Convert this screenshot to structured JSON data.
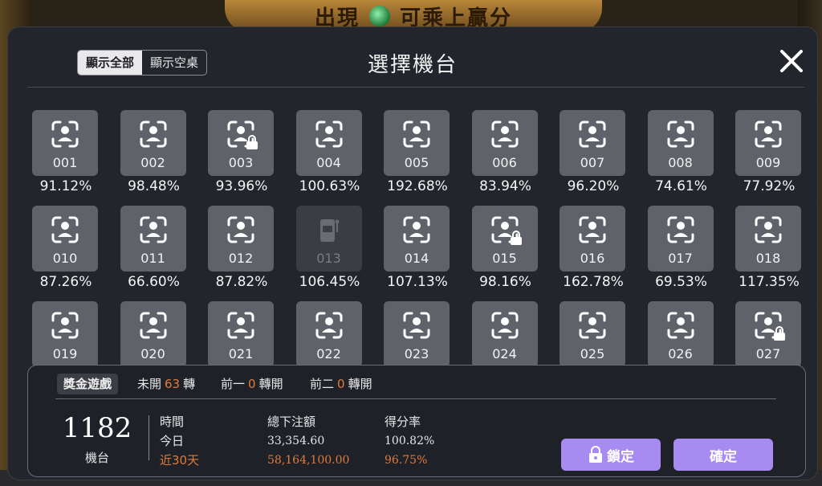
{
  "background": {
    "banner_text_left": "出現",
    "banner_text_right": "可乘上贏分"
  },
  "header": {
    "filters": [
      {
        "label": "顯示全部",
        "active": true
      },
      {
        "label": "顯示空桌",
        "active": false
      }
    ],
    "title": "選擇機台",
    "close_icon": "close-icon"
  },
  "machines": [
    {
      "number": "001",
      "rate": "91.12%",
      "locked": false,
      "disabled": false
    },
    {
      "number": "002",
      "rate": "98.48%",
      "locked": false,
      "disabled": false
    },
    {
      "number": "003",
      "rate": "93.96%",
      "locked": true,
      "disabled": false
    },
    {
      "number": "004",
      "rate": "100.63%",
      "locked": false,
      "disabled": false
    },
    {
      "number": "005",
      "rate": "192.68%",
      "locked": false,
      "disabled": false
    },
    {
      "number": "006",
      "rate": "83.94%",
      "locked": false,
      "disabled": false
    },
    {
      "number": "007",
      "rate": "96.20%",
      "locked": false,
      "disabled": false
    },
    {
      "number": "008",
      "rate": "74.61%",
      "locked": false,
      "disabled": false
    },
    {
      "number": "009",
      "rate": "77.92%",
      "locked": false,
      "disabled": false
    },
    {
      "number": "010",
      "rate": "87.26%",
      "locked": false,
      "disabled": false
    },
    {
      "number": "011",
      "rate": "66.60%",
      "locked": false,
      "disabled": false
    },
    {
      "number": "012",
      "rate": "87.82%",
      "locked": false,
      "disabled": false
    },
    {
      "number": "013",
      "rate": "106.45%",
      "locked": false,
      "disabled": true
    },
    {
      "number": "014",
      "rate": "107.13%",
      "locked": false,
      "disabled": false
    },
    {
      "number": "015",
      "rate": "98.16%",
      "locked": true,
      "disabled": false
    },
    {
      "number": "016",
      "rate": "162.78%",
      "locked": false,
      "disabled": false
    },
    {
      "number": "017",
      "rate": "69.53%",
      "locked": false,
      "disabled": false
    },
    {
      "number": "018",
      "rate": "117.35%",
      "locked": false,
      "disabled": false
    },
    {
      "number": "019",
      "rate": "",
      "locked": false,
      "disabled": false
    },
    {
      "number": "020",
      "rate": "",
      "locked": false,
      "disabled": false
    },
    {
      "number": "021",
      "rate": "",
      "locked": false,
      "disabled": false
    },
    {
      "number": "022",
      "rate": "",
      "locked": false,
      "disabled": false
    },
    {
      "number": "023",
      "rate": "",
      "locked": false,
      "disabled": false
    },
    {
      "number": "024",
      "rate": "",
      "locked": false,
      "disabled": false
    },
    {
      "number": "025",
      "rate": "",
      "locked": false,
      "disabled": false
    },
    {
      "number": "026",
      "rate": "",
      "locked": false,
      "disabled": false
    },
    {
      "number": "027",
      "rate": "",
      "locked": true,
      "disabled": false
    }
  ],
  "info": {
    "jackpot_label": "獎金遊戲",
    "not_opened": {
      "label": "未開",
      "value": "63",
      "unit": "轉"
    },
    "prev1": {
      "label": "前一",
      "value": "0",
      "unit": "轉開"
    },
    "prev2": {
      "label": "前二",
      "value": "0",
      "unit": "轉開"
    },
    "machine_count": "1182",
    "machine_count_label": "機台",
    "table": {
      "headers": [
        "時間",
        "總下注額",
        "得分率"
      ],
      "today": {
        "label": "今日",
        "bet": "33,354.60",
        "rate": "100.82%"
      },
      "last30": {
        "label": "近30天",
        "bet": "58,164,100.00",
        "rate": "96.75%"
      }
    },
    "lock_button": "鎖定",
    "confirm_button": "確定"
  },
  "colors": {
    "accent": "#a78bf0",
    "highlight": "#e07a3a",
    "modal_bg": "#23252c",
    "tile_bg": "#60626a"
  }
}
